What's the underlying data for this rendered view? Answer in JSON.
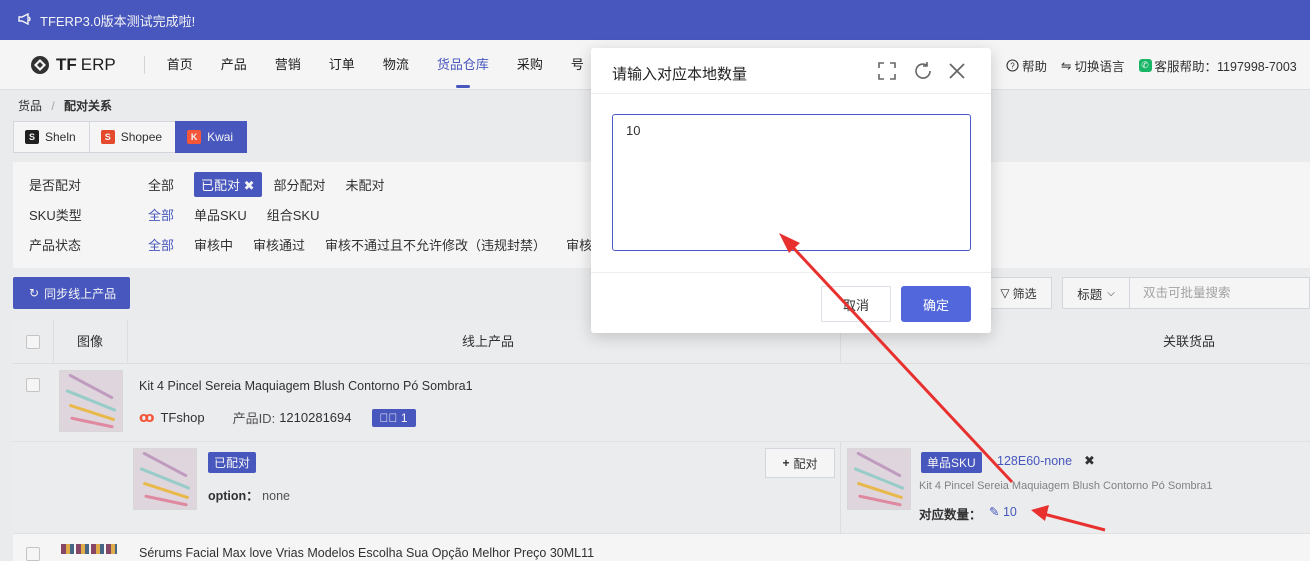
{
  "announcement": {
    "icon": "megaphone-icon",
    "text": "TFERP3.0版本测试完成啦!"
  },
  "logo": {
    "brand": "TF",
    "suffix": "ERP"
  },
  "nav": {
    "items": [
      "首页",
      "产品",
      "营销",
      "订单",
      "物流",
      "货品仓库",
      "采购",
      "号"
    ],
    "active_index": 5,
    "help": "帮助",
    "language": "切换语言",
    "support": "客服帮助：1197998-7003"
  },
  "breadcrumb": {
    "root": "货品",
    "sep": "/",
    "current": "配对关系"
  },
  "platforms": [
    {
      "label": "Sheln",
      "icon": "S",
      "color": "#222222",
      "active": false
    },
    {
      "label": "Shopee",
      "icon": "S",
      "color": "#ee4d2d",
      "active": false
    },
    {
      "label": "Kwai",
      "icon": "K",
      "color": "#ff5a3c",
      "active": true
    }
  ],
  "filters": {
    "paired": {
      "label": "是否配对",
      "options": [
        "全部",
        "已配对",
        "部分配对",
        "未配对"
      ],
      "selected_tag": "已配对 ✖"
    },
    "sku_type": {
      "label": "SKU类型",
      "options": [
        "全部",
        "单品SKU",
        "组合SKU"
      ]
    },
    "status": {
      "label": "产品状态",
      "options": [
        "全部",
        "审核中",
        "审核通过",
        "审核不通过且不允许修改（违规封禁）",
        "审核"
      ]
    }
  },
  "toolbar": {
    "sync": "同步线上产品",
    "filter": "筛选",
    "search_field": "标题",
    "search_placeholder": "双击可批量搜索"
  },
  "table": {
    "headers": {
      "image": "图像",
      "online": "线上产品",
      "linked": "关联货品"
    },
    "rows": [
      {
        "title": "Kit 4 Pincel Sereia Maquiagem Blush Contorno Pó Sombra1",
        "shop": "TFshop",
        "product_id_label": "产品ID:",
        "product_id": "1210281694",
        "pair_count": "1",
        "status": "已配对",
        "option_label": "option：",
        "option_value": "none",
        "pair_button": "配对",
        "linked": {
          "type": "单品SKU",
          "sku": "128E60-none",
          "title": "Kit 4 Pincel Sereia Maquiagem Blush Contorno Pó Sombra1",
          "qty_label": "对应数量：",
          "qty": "10"
        }
      },
      {
        "title": "Sérums Facial Max love Vrias Modelos Escolha Sua Opção Melhor Preço 30ML11"
      }
    ]
  },
  "modal": {
    "title": "请输入对应本地数量",
    "value": "10",
    "cancel": "取消",
    "ok": "确定"
  },
  "colors": {
    "primary": "#4b5bc6",
    "ok_button": "#5367dc",
    "arrow": "#e8312f",
    "success": "#19be6b"
  }
}
